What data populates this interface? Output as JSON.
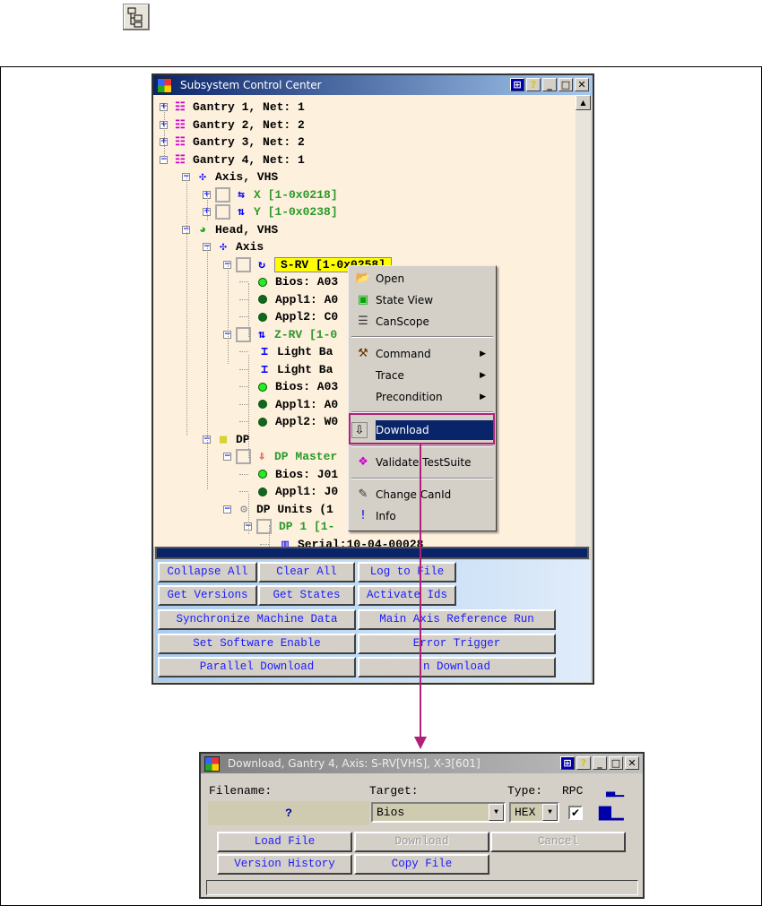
{
  "main_window": {
    "title": "Subsystem Control Center",
    "tree": [
      {
        "level": 0,
        "label": "Gantry 1, Net: 1",
        "expander": "+",
        "icon": "gantry-icon",
        "color": "#000000"
      },
      {
        "level": 0,
        "label": "Gantry 2, Net: 2",
        "expander": "+",
        "icon": "gantry-icon",
        "color": "#000000"
      },
      {
        "level": 0,
        "label": "Gantry 3, Net: 2",
        "expander": "+",
        "icon": "gantry-icon",
        "color": "#000000"
      },
      {
        "level": 0,
        "label": "Gantry 4, Net: 1",
        "expander": "-",
        "icon": "gantry-icon",
        "color": "#000000"
      },
      {
        "level": 1,
        "label": "Axis, VHS",
        "expander": "-",
        "icon": "axis-move-icon",
        "color": "#000000"
      },
      {
        "level": 2,
        "label": "X [1-0x0218]",
        "expander": "+",
        "icon": "horizontal-arrows-icon",
        "checkbox": true,
        "color": "#2a9a2a"
      },
      {
        "level": 2,
        "label": "Y [1-0x0238]",
        "expander": "+",
        "icon": "vertical-arrows-icon",
        "checkbox": true,
        "color": "#2a9a2a"
      },
      {
        "level": 1,
        "label": "Head, VHS",
        "expander": "-",
        "icon": "head-icon",
        "color": "#000000"
      },
      {
        "level": 2,
        "label": "Axis",
        "expander": "-",
        "icon": "axis-move-icon",
        "color": "#000000"
      },
      {
        "level": 3,
        "label": "S-RV [1-0x0258]",
        "expander": "-",
        "icon": "rotate-icon",
        "checkbox": true,
        "color": "#000000",
        "highlight": "#ffff00"
      },
      {
        "level": 4,
        "label": "Bios: A03",
        "icon": "status-dot-light",
        "color": "#000000"
      },
      {
        "level": 4,
        "label": "Appl1: A0",
        "icon": "status-dot-dark",
        "color": "#000000"
      },
      {
        "level": 4,
        "label": "Appl2: C0",
        "icon": "status-dot-dark",
        "color": "#000000"
      },
      {
        "level": 3,
        "label": "Z-RV [1-0",
        "expander": "-",
        "icon": "vertical-arrows-icon",
        "checkbox": true,
        "color": "#2a9a2a"
      },
      {
        "level": 4,
        "label": "Light Ba",
        "icon": "light-barrier-icon",
        "color": "#000000"
      },
      {
        "level": 4,
        "label": "Light Ba",
        "icon": "light-barrier-icon",
        "color": "#000000"
      },
      {
        "level": 4,
        "label": "Bios: A03",
        "icon": "status-dot-light",
        "color": "#000000"
      },
      {
        "level": 4,
        "label": "Appl1: A0",
        "icon": "status-dot-dark",
        "color": "#000000"
      },
      {
        "level": 4,
        "label": "Appl2: W0",
        "icon": "status-dot-dark",
        "color": "#000000"
      },
      {
        "level": 2,
        "label": "DP",
        "expander": "-",
        "icon": "dp-icon",
        "color": "#000000"
      },
      {
        "level": 3,
        "label": "DP Master",
        "expander": "-",
        "icon": "download-icon",
        "checkbox": true,
        "color": "#2a9a2a"
      },
      {
        "level": 4,
        "label": "Bios: J01",
        "icon": "status-dot-light",
        "color": "#000000"
      },
      {
        "level": 4,
        "label": "Appl1: J0",
        "icon": "status-dot-dark",
        "color": "#000000"
      },
      {
        "level": 3,
        "label": "DP Units (1",
        "expander": "-",
        "icon": "gear-icon",
        "color": "#000000"
      },
      {
        "level": 4,
        "label": "DP 1 [1-",
        "expander": "-",
        "checkbox": true,
        "color": "#2a9a2a"
      },
      {
        "level": 5,
        "label": "Serial:10-04-00028",
        "icon": "barcode-icon",
        "color": "#000000"
      }
    ],
    "buttons": {
      "collapse_all": "Collapse All",
      "clear_all": "Clear All",
      "log_to_file": "Log to File",
      "get_versions": "Get Versions",
      "get_states": "Get States",
      "activate_ids": "Activate Ids",
      "sync_machine_data": "Synchronize Machine Data",
      "main_axis_ref_run": "Main Axis Reference Run",
      "set_software_enable": "Set Software Enable",
      "error_trigger": "Error Trigger",
      "parallel_download": "Parallel Download",
      "download": "n Download"
    }
  },
  "context_menu": {
    "items": [
      {
        "label": "Open",
        "icon": "folder-open-icon"
      },
      {
        "label": "State View",
        "icon": "state-view-icon"
      },
      {
        "label": "CanScope",
        "icon": "document-icon"
      },
      {
        "label": "Command",
        "icon": "hammer-icon",
        "submenu": true
      },
      {
        "label": "Trace",
        "submenu": true
      },
      {
        "label": "Precondition",
        "submenu": true
      },
      {
        "label": "Download",
        "icon": "download-icon",
        "selected": true
      },
      {
        "label": "Validate TestSuite",
        "icon": "molecule-icon"
      },
      {
        "label": "Change CanId",
        "icon": "change-id-icon"
      },
      {
        "label": "Info",
        "icon": "info-icon"
      }
    ]
  },
  "download_dialog": {
    "title": "Download, Gantry 4, Axis: S-RV[VHS], X-3[601]",
    "filename_label": "Filename:",
    "filename_value": "?",
    "target_label": "Target:",
    "target_value": "Bios",
    "type_label": "Type:",
    "type_value": "HEX",
    "rpc_label": "RPC",
    "rpc_checked": true,
    "buttons": {
      "load_file": "Load File",
      "download": "Download",
      "cancel": "Cancel",
      "version_history": "Version History",
      "copy_file": "Copy File"
    }
  },
  "colors": {
    "highlight": "#b0207a",
    "tree_bg": "#fdf0dc",
    "selection": "#0a246a"
  }
}
